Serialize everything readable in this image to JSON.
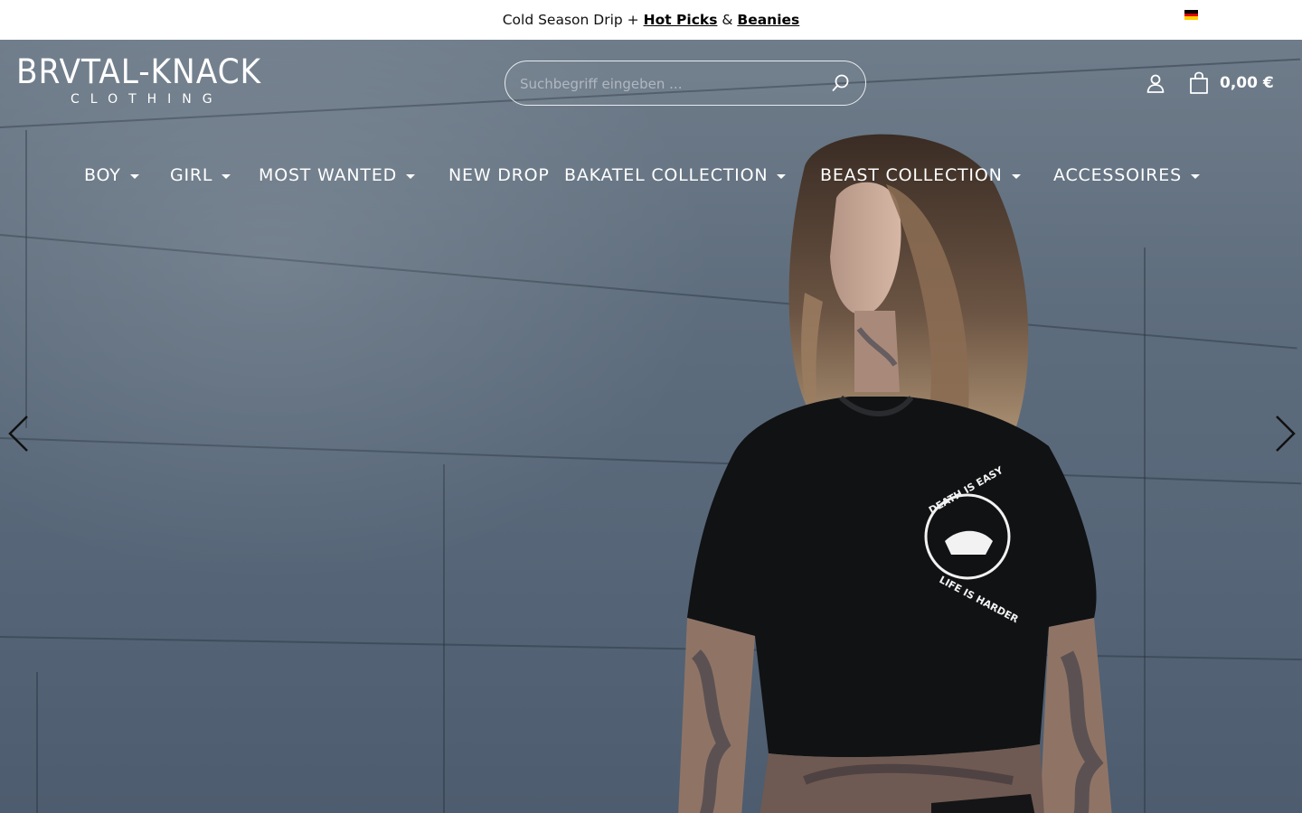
{
  "promo": {
    "text_before": "Cold Season Drip +",
    "link1": "Hot Picks",
    "between": "&",
    "link2": "Beanies"
  },
  "language": {
    "flag_icon": "germany-flag-icon",
    "colors": [
      "#000000",
      "#dd0000",
      "#ffce00"
    ]
  },
  "header": {
    "logo_text": "BRVTAL-KNACK",
    "logo_sub": "CLOTHING",
    "search_placeholder": "Suchbegriff eingeben ...",
    "cart_amount": "0,00 €"
  },
  "nav": {
    "items": [
      {
        "label": "BOY",
        "has_dropdown": true
      },
      {
        "label": "GIRL",
        "has_dropdown": true
      },
      {
        "label": "MOST WANTED",
        "has_dropdown": true
      },
      {
        "label": "NEW DROP",
        "has_dropdown": false
      },
      {
        "label": "BAKATEL COLLECTION",
        "has_dropdown": true
      },
      {
        "label": "BEAST COLLECTION",
        "has_dropdown": true
      },
      {
        "label": "ACCESSOIRES",
        "has_dropdown": true
      }
    ]
  },
  "hero": {
    "shirt_print_top": "DEATH IS EASY",
    "shirt_print_bottom": "LIFE IS HARDER"
  },
  "colors": {
    "accent": "#ffffff",
    "topbar_bg": "#ffffff",
    "hero_wall": "#5e6d7d"
  }
}
